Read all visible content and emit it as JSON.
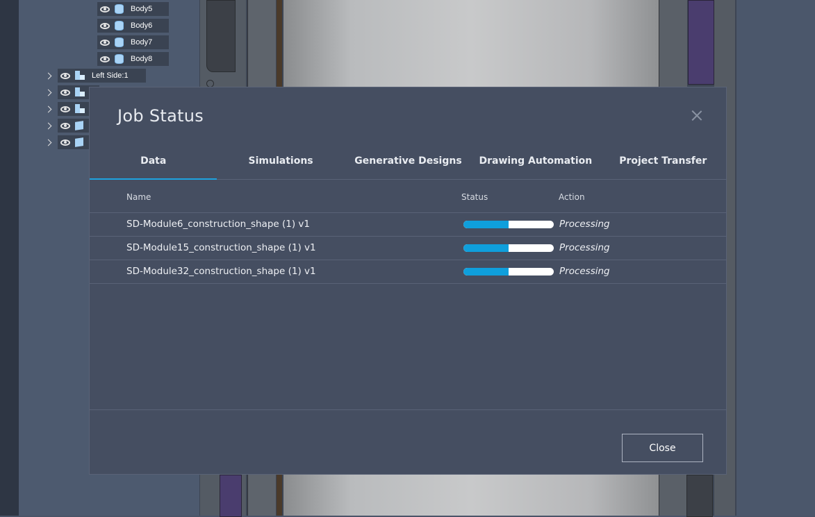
{
  "background": {
    "tree_items": [
      {
        "label": "Body5",
        "icon": "body-cylinder-icon"
      },
      {
        "label": "Body6",
        "icon": "body-cylinder-icon"
      },
      {
        "label": "Body7",
        "icon": "body-cylinder-icon"
      },
      {
        "label": "Body8",
        "icon": "body-cylinder-icon"
      },
      {
        "label": "Left Side:1",
        "icon": "component-icon"
      }
    ]
  },
  "dialog": {
    "title": "Job Status",
    "tabs": [
      {
        "label": "Data",
        "active": true
      },
      {
        "label": "Simulations",
        "active": false
      },
      {
        "label": "Generative Designs",
        "active": false
      },
      {
        "label": "Drawing Automation",
        "active": false
      },
      {
        "label": "Project Transfer",
        "active": false
      }
    ],
    "columns": {
      "name": "Name",
      "status": "Status",
      "action": "Action"
    },
    "jobs": [
      {
        "name": "SD-Module6_construction_shape (1) v1",
        "progress": 0.5,
        "status": "Processing"
      },
      {
        "name": "SD-Module15_construction_shape (1) v1",
        "progress": 0.5,
        "status": "Processing"
      },
      {
        "name": "SD-Module32_construction_shape (1) v1",
        "progress": 0.5,
        "status": "Processing"
      }
    ],
    "close_label": "Close",
    "colors": {
      "accent": "#1ea3e0",
      "progress_fill": "#0f9fdc",
      "panel": "#454e61"
    }
  }
}
